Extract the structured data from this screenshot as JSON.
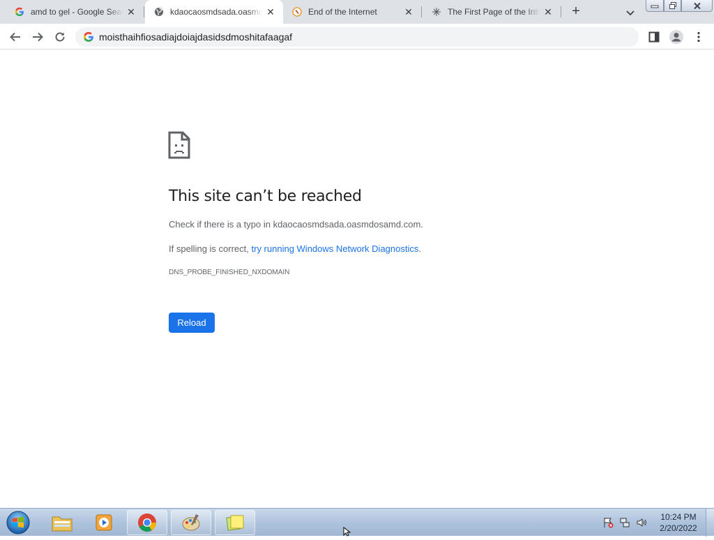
{
  "browser": {
    "tabs": [
      {
        "title": "amd to gel - Google Search",
        "favicon": "google-icon",
        "active": false
      },
      {
        "title": "kdaocaosmdsada.oasmdosamd.com",
        "favicon": "globe-icon",
        "active": true
      },
      {
        "title": "End of the Internet",
        "favicon": "compass-icon",
        "active": false
      },
      {
        "title": "The First Page of the Internet",
        "favicon": "sparkle-icon",
        "active": false
      }
    ],
    "omnibox": {
      "value": "moisthaihfiosadiajdoiajdasidsdmoshitafaagaf"
    }
  },
  "error_page": {
    "title": "This site can’t be reached",
    "line1": "Check if there is a typo in kdaocaosmdsada.oasmdosamd.com.",
    "line2_prefix": "If spelling is correct, ",
    "line2_link": "try running Windows Network Diagnostics",
    "line2_suffix": ".",
    "error_code": "DNS_PROBE_FINISHED_NXDOMAIN",
    "reload_label": "Reload"
  },
  "taskbar": {
    "apps": [
      {
        "name": "file-explorer-icon",
        "open": false
      },
      {
        "name": "media-player-icon",
        "open": false
      },
      {
        "name": "chrome-icon",
        "open": true
      },
      {
        "name": "paint-icon",
        "open": true
      },
      {
        "name": "sticky-notes-icon",
        "open": true
      }
    ],
    "time": "10:24 PM",
    "date": "2/20/2022"
  },
  "colors": {
    "accent": "#1a73e8",
    "tab_strip": "#dee1e6",
    "text_secondary": "#5f6368"
  }
}
